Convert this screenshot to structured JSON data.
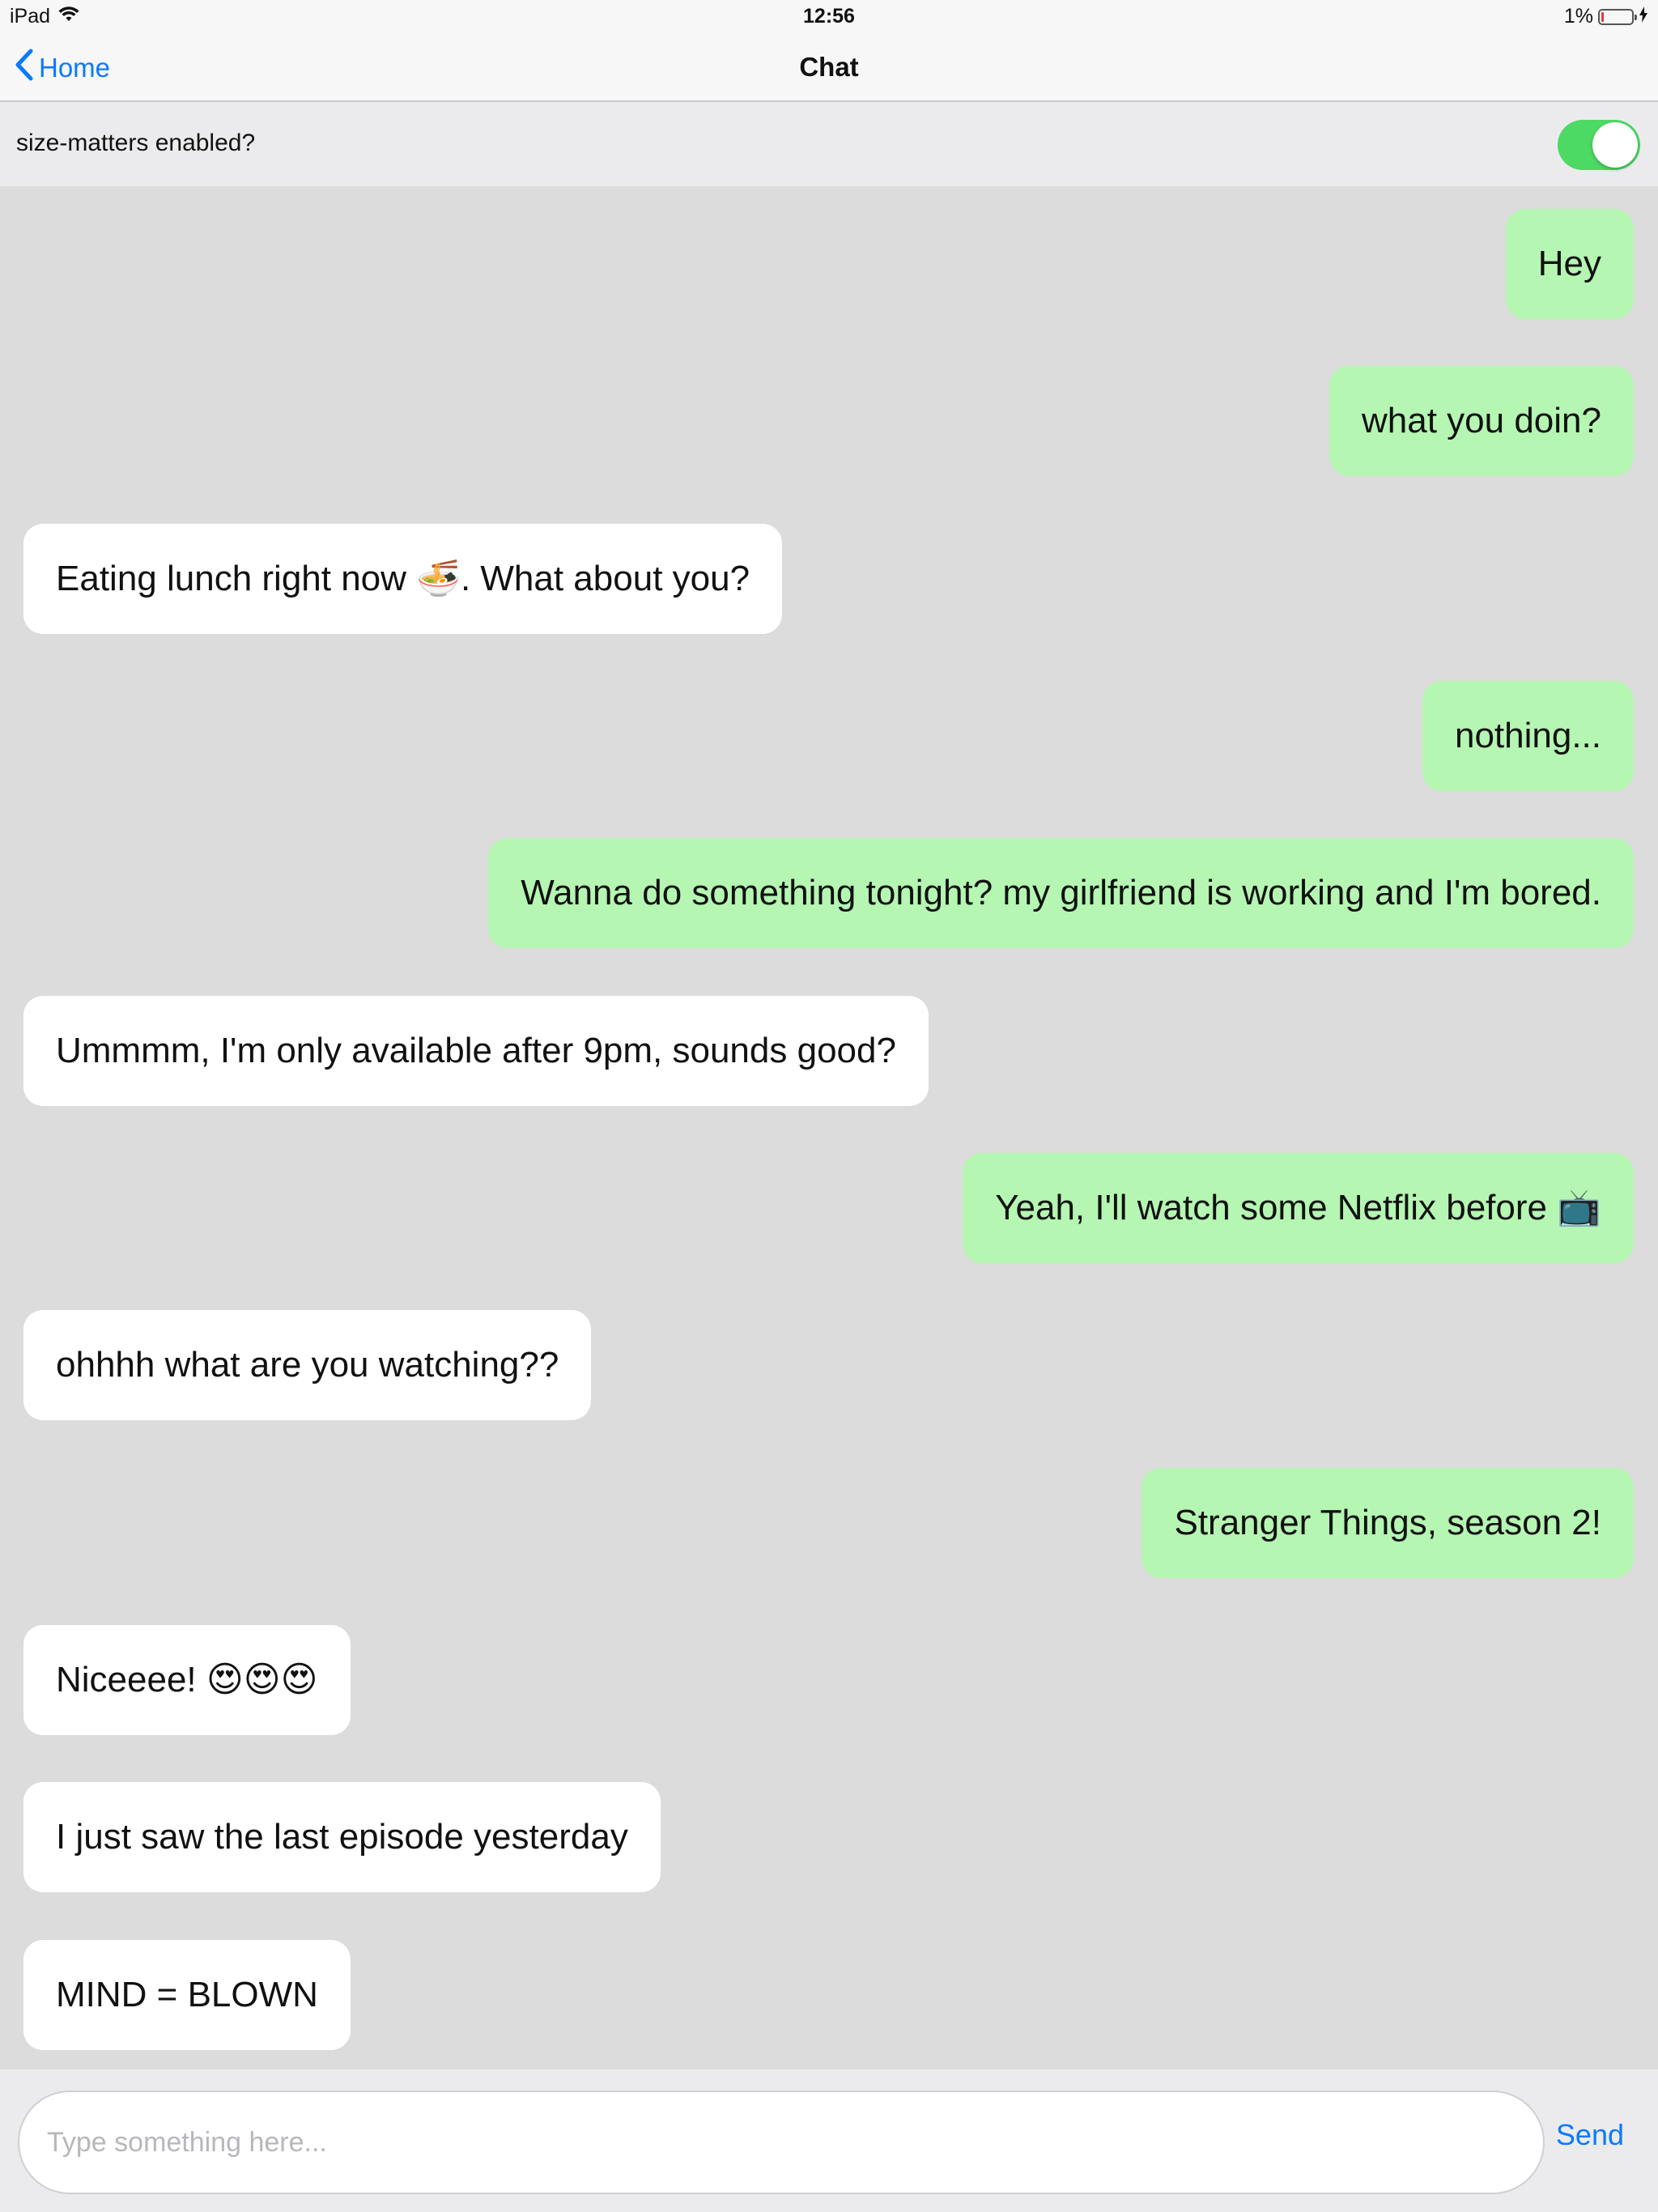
{
  "status_bar": {
    "device": "iPad",
    "time": "12:56",
    "battery": "1%"
  },
  "nav": {
    "back_label": "Home",
    "title": "Chat"
  },
  "settings": {
    "label": "size-matters enabled?",
    "enabled": true
  },
  "messages": [
    {
      "side": "outgoing",
      "text": "Hey"
    },
    {
      "side": "outgoing",
      "text": "what you doin?"
    },
    {
      "side": "incoming",
      "text": "Eating lunch right now 🍜. What about you?"
    },
    {
      "side": "outgoing",
      "text": "nothing..."
    },
    {
      "side": "outgoing",
      "text": "Wanna do something tonight? my girlfriend is working and I'm bored."
    },
    {
      "side": "incoming",
      "text": "Ummmm, I'm only available after 9pm, sounds good?"
    },
    {
      "side": "outgoing",
      "text": "Yeah, I'll watch some Netflix before 📺"
    },
    {
      "side": "incoming",
      "text": "ohhhh what are you watching??"
    },
    {
      "side": "outgoing",
      "text": "Stranger Things, season 2!"
    },
    {
      "side": "incoming",
      "text": "Niceeee! 😍😍😍"
    },
    {
      "side": "incoming",
      "text": "I just saw the last episode yesterday"
    },
    {
      "side": "incoming",
      "text": "MIND = BLOWN"
    }
  ],
  "composer": {
    "placeholder": "Type something here...",
    "value": "",
    "send_label": "Send"
  },
  "colors": {
    "outgoing_bubble": "#b5f6b2",
    "incoming_bubble": "#ffffff",
    "chat_background": "#dcdcdc",
    "accent": "#0a7aff",
    "toggle_on": "#4cd964"
  }
}
